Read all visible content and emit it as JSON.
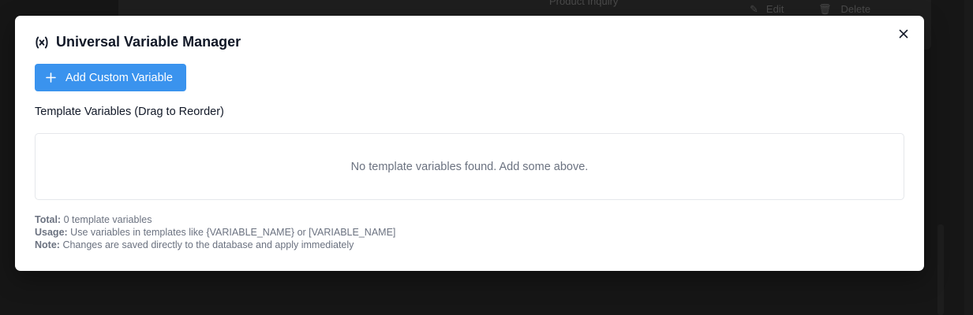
{
  "background": {
    "row_title": "Product Inquiry",
    "edit_label": "Edit",
    "delete_label": "Delete"
  },
  "modal": {
    "title": "Universal Variable Manager",
    "title_icon": "variable-icon",
    "close_icon": "close-icon",
    "add_button_label": "Add Custom Variable",
    "add_button_icon": "plus-icon",
    "section_label": "Template Variables (Drag to Reorder)",
    "empty_message": "No template variables found. Add some above.",
    "notes": {
      "total_key": "Total:",
      "total_value": "0 template variables",
      "usage_key": "Usage:",
      "usage_value": "Use variables in templates like {VARIABLE_NAME} or [VARIABLE_NAME]",
      "note_key": "Note:",
      "note_value": "Changes are saved directly to the database and apply immediately"
    }
  },
  "colors": {
    "accent": "#3a93ee",
    "overlay": "#161616",
    "text_primary": "#111827",
    "text_muted": "#6b7280",
    "border": "#e5e7eb"
  }
}
